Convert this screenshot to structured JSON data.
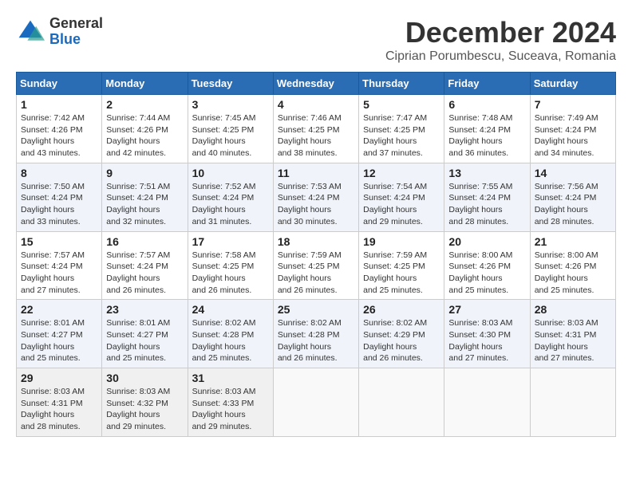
{
  "header": {
    "logo": {
      "general": "General",
      "blue": "Blue"
    },
    "title": "December 2024",
    "subtitle": "Ciprian Porumbescu, Suceava, Romania"
  },
  "calendar": {
    "days_of_week": [
      "Sunday",
      "Monday",
      "Tuesday",
      "Wednesday",
      "Thursday",
      "Friday",
      "Saturday"
    ],
    "weeks": [
      [
        null,
        null,
        null,
        null,
        null,
        null,
        null
      ]
    ],
    "cells": [
      {
        "day": "1",
        "col": 0,
        "sunrise": "7:42 AM",
        "sunset": "4:26 PM",
        "daylight": "8 hours and 43 minutes."
      },
      {
        "day": "2",
        "col": 1,
        "sunrise": "7:44 AM",
        "sunset": "4:26 PM",
        "daylight": "8 hours and 42 minutes."
      },
      {
        "day": "3",
        "col": 2,
        "sunrise": "7:45 AM",
        "sunset": "4:25 PM",
        "daylight": "8 hours and 40 minutes."
      },
      {
        "day": "4",
        "col": 3,
        "sunrise": "7:46 AM",
        "sunset": "4:25 PM",
        "daylight": "8 hours and 38 minutes."
      },
      {
        "day": "5",
        "col": 4,
        "sunrise": "7:47 AM",
        "sunset": "4:25 PM",
        "daylight": "8 hours and 37 minutes."
      },
      {
        "day": "6",
        "col": 5,
        "sunrise": "7:48 AM",
        "sunset": "4:24 PM",
        "daylight": "8 hours and 36 minutes."
      },
      {
        "day": "7",
        "col": 6,
        "sunrise": "7:49 AM",
        "sunset": "4:24 PM",
        "daylight": "8 hours and 34 minutes."
      },
      {
        "day": "8",
        "col": 0,
        "sunrise": "7:50 AM",
        "sunset": "4:24 PM",
        "daylight": "8 hours and 33 minutes."
      },
      {
        "day": "9",
        "col": 1,
        "sunrise": "7:51 AM",
        "sunset": "4:24 PM",
        "daylight": "8 hours and 32 minutes."
      },
      {
        "day": "10",
        "col": 2,
        "sunrise": "7:52 AM",
        "sunset": "4:24 PM",
        "daylight": "8 hours and 31 minutes."
      },
      {
        "day": "11",
        "col": 3,
        "sunrise": "7:53 AM",
        "sunset": "4:24 PM",
        "daylight": "8 hours and 30 minutes."
      },
      {
        "day": "12",
        "col": 4,
        "sunrise": "7:54 AM",
        "sunset": "4:24 PM",
        "daylight": "8 hours and 29 minutes."
      },
      {
        "day": "13",
        "col": 5,
        "sunrise": "7:55 AM",
        "sunset": "4:24 PM",
        "daylight": "8 hours and 28 minutes."
      },
      {
        "day": "14",
        "col": 6,
        "sunrise": "7:56 AM",
        "sunset": "4:24 PM",
        "daylight": "8 hours and 28 minutes."
      },
      {
        "day": "15",
        "col": 0,
        "sunrise": "7:57 AM",
        "sunset": "4:24 PM",
        "daylight": "8 hours and 27 minutes."
      },
      {
        "day": "16",
        "col": 1,
        "sunrise": "7:57 AM",
        "sunset": "4:24 PM",
        "daylight": "8 hours and 26 minutes."
      },
      {
        "day": "17",
        "col": 2,
        "sunrise": "7:58 AM",
        "sunset": "4:25 PM",
        "daylight": "8 hours and 26 minutes."
      },
      {
        "day": "18",
        "col": 3,
        "sunrise": "7:59 AM",
        "sunset": "4:25 PM",
        "daylight": "8 hours and 26 minutes."
      },
      {
        "day": "19",
        "col": 4,
        "sunrise": "7:59 AM",
        "sunset": "4:25 PM",
        "daylight": "8 hours and 25 minutes."
      },
      {
        "day": "20",
        "col": 5,
        "sunrise": "8:00 AM",
        "sunset": "4:26 PM",
        "daylight": "8 hours and 25 minutes."
      },
      {
        "day": "21",
        "col": 6,
        "sunrise": "8:00 AM",
        "sunset": "4:26 PM",
        "daylight": "8 hours and 25 minutes."
      },
      {
        "day": "22",
        "col": 0,
        "sunrise": "8:01 AM",
        "sunset": "4:27 PM",
        "daylight": "8 hours and 25 minutes."
      },
      {
        "day": "23",
        "col": 1,
        "sunrise": "8:01 AM",
        "sunset": "4:27 PM",
        "daylight": "8 hours and 25 minutes."
      },
      {
        "day": "24",
        "col": 2,
        "sunrise": "8:02 AM",
        "sunset": "4:28 PM",
        "daylight": "8 hours and 25 minutes."
      },
      {
        "day": "25",
        "col": 3,
        "sunrise": "8:02 AM",
        "sunset": "4:28 PM",
        "daylight": "8 hours and 26 minutes."
      },
      {
        "day": "26",
        "col": 4,
        "sunrise": "8:02 AM",
        "sunset": "4:29 PM",
        "daylight": "8 hours and 26 minutes."
      },
      {
        "day": "27",
        "col": 5,
        "sunrise": "8:03 AM",
        "sunset": "4:30 PM",
        "daylight": "8 hours and 27 minutes."
      },
      {
        "day": "28",
        "col": 6,
        "sunrise": "8:03 AM",
        "sunset": "4:31 PM",
        "daylight": "8 hours and 27 minutes."
      },
      {
        "day": "29",
        "col": 0,
        "sunrise": "8:03 AM",
        "sunset": "4:31 PM",
        "daylight": "8 hours and 28 minutes."
      },
      {
        "day": "30",
        "col": 1,
        "sunrise": "8:03 AM",
        "sunset": "4:32 PM",
        "daylight": "8 hours and 29 minutes."
      },
      {
        "day": "31",
        "col": 2,
        "sunrise": "8:03 AM",
        "sunset": "4:33 PM",
        "daylight": "8 hours and 29 minutes."
      }
    ]
  }
}
